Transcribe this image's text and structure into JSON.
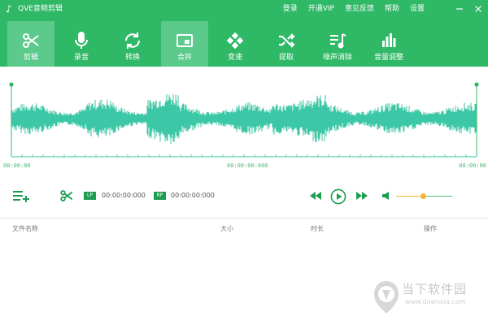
{
  "app": {
    "title": "QVE音频剪辑",
    "logo_icon": "music-note-icon"
  },
  "top_menu": [
    {
      "label": "登录"
    },
    {
      "label": "开通VIP"
    },
    {
      "label": "意见反馈"
    },
    {
      "label": "帮助"
    },
    {
      "label": "设置"
    }
  ],
  "window_controls": [
    "minimize-icon",
    "close-icon"
  ],
  "toolbar": {
    "active_index": 0,
    "items": [
      {
        "label": "剪辑",
        "icon": "scissors-icon"
      },
      {
        "label": "录音",
        "icon": "microphone-icon"
      },
      {
        "label": "转换",
        "icon": "convert-icon"
      },
      {
        "label": "合并",
        "icon": "merge-icon"
      },
      {
        "label": "变速",
        "icon": "speed-icon"
      },
      {
        "label": "提取",
        "icon": "extract-icon"
      },
      {
        "label": "噪声消除",
        "icon": "noise-reduction-icon"
      },
      {
        "label": "音量调整",
        "icon": "volume-adjust-icon"
      }
    ]
  },
  "waveform": {
    "time_left": "00:00:00",
    "time_center": "00:00:00:000",
    "time_right": "00:00:00"
  },
  "controls": {
    "add_icon": "add-file-icon",
    "cut_icon": "scissors-icon",
    "lp_label": "LP",
    "lp_time": "00:00:00:000",
    "rp_label": "RP",
    "rp_time": "00:00:00:000",
    "volume_level": 0.48
  },
  "file_list": {
    "columns": [
      "文件名称",
      "大小",
      "时长",
      "操作"
    ],
    "rows": []
  },
  "watermark": {
    "cn": "当下软件园",
    "url": "www.downxia.com"
  },
  "colors": {
    "brand_green": "#2fb866",
    "wave_teal": "#3cc7a6",
    "accent_dark_green": "#1e9d52",
    "volume_knob": "#f4b537"
  }
}
